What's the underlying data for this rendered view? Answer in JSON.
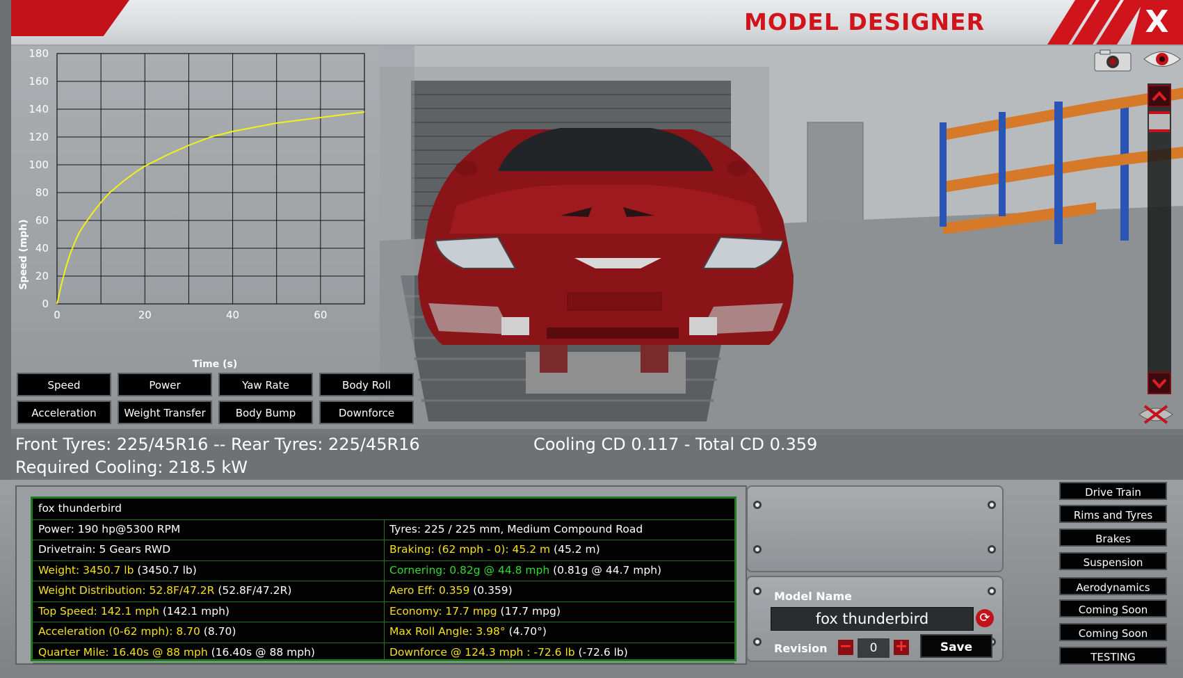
{
  "header": {
    "title": "MODEL DESIGNER",
    "close_label": "X"
  },
  "chart_panel": {
    "buttons": [
      {
        "label": "Speed"
      },
      {
        "label": "Power"
      },
      {
        "label": "Yaw Rate"
      },
      {
        "label": "Body Roll"
      },
      {
        "label": "Acceleration"
      },
      {
        "label": "Weight Transfer"
      },
      {
        "label": "Body Bump"
      },
      {
        "label": "Downforce"
      }
    ]
  },
  "chart_data": {
    "type": "line",
    "xlabel": "Time (s)",
    "ylabel": "Speed (mph)",
    "xlim": [
      0,
      70
    ],
    "ylim": [
      0,
      180
    ],
    "xticks": [
      0,
      20,
      40,
      60
    ],
    "yticks": [
      0,
      20,
      40,
      60,
      80,
      100,
      120,
      140,
      160,
      180
    ],
    "grid": true,
    "series": [
      {
        "color": "#f2f21a",
        "x": [
          0,
          1,
          2,
          3,
          4,
          5,
          6,
          8,
          10,
          12,
          15,
          18,
          20,
          25,
          30,
          35,
          40,
          45,
          50,
          55,
          60,
          65,
          70
        ],
        "y": [
          0,
          14,
          26,
          36,
          44,
          51,
          56,
          65,
          73,
          80,
          88,
          95,
          99,
          107,
          114,
          120,
          124,
          127,
          130,
          132,
          134,
          136,
          138
        ]
      }
    ]
  },
  "info_strip": {
    "tyres": "Front Tyres: 225/45R16 -- Rear Tyres: 225/45R16",
    "cooling_cd": "Cooling CD 0.117 - Total CD 0.359",
    "required_cooling": "Required Cooling: 218.5 kW"
  },
  "stats": {
    "name": "fox thunderbird",
    "rows": [
      {
        "left": "Power: 190 hp@5300 RPM",
        "left_value": "",
        "left_color": "white",
        "right": "Tyres: 225 / 225 mm, Medium Compound Road",
        "right_value": "",
        "right_color": "white"
      },
      {
        "left": "Drivetrain: 5 Gears RWD",
        "left_value": "",
        "left_color": "white",
        "right": "Braking: (62 mph - 0): 45.2 m",
        "right_value": " (45.2 m)",
        "right_color": "yellow"
      },
      {
        "left": "Weight: 3450.7 lb",
        "left_value": " (3450.7 lb)",
        "left_color": "yellow",
        "right": "Cornering: 0.82g @ 44.8 mph",
        "right_value": " (0.81g @ 44.7 mph)",
        "right_color": "green"
      },
      {
        "left": "Weight Distribution: 52.8F/47.2R",
        "left_value": " (52.8F/47.2R)",
        "left_color": "yellow",
        "right": "Aero Eff: 0.359",
        "right_value": " (0.359)",
        "right_color": "yellow"
      },
      {
        "left": "Top Speed: 142.1 mph",
        "left_value": " (142.1 mph)",
        "left_color": "yellow",
        "right": "Economy: 17.7 mpg",
        "right_value": " (17.7 mpg)",
        "right_color": "yellow"
      },
      {
        "left": "Acceleration (0-62 mph): 8.70",
        "left_value": " (8.70)",
        "left_color": "yellow",
        "right": "Max Roll Angle: 3.98°",
        "right_value": " (4.70°)",
        "right_color": "yellow"
      },
      {
        "left": "Quarter Mile: 16.40s @ 88 mph",
        "left_value": " (16.40s @ 88 mph)",
        "left_color": "yellow",
        "right": "Downforce @ 124.3 mph : -72.6 lb",
        "right_value": " (-72.6 lb)",
        "right_color": "yellow"
      }
    ]
  },
  "model_panel": {
    "model_name_label": "Model Name",
    "model_name_value": "fox thunderbird",
    "revision_label": "Revision",
    "revision_value": "0",
    "save_label": "Save"
  },
  "side_menu": {
    "items": [
      {
        "label": "Drive Train"
      },
      {
        "label": "Rims and Tyres"
      },
      {
        "label": "Brakes"
      },
      {
        "label": "Suspension"
      },
      {
        "label": "Aerodynamics"
      },
      {
        "label": "Coming Soon"
      },
      {
        "label": "Coming Soon"
      },
      {
        "label": "TESTING"
      }
    ]
  },
  "icons": {
    "camera": "camera-icon",
    "eye": "eye-icon",
    "scroll_up": "chevron-up-icon",
    "scroll_down": "chevron-down-icon",
    "hide_ui": "hide-view-icon",
    "reset_name": "refresh-icon"
  },
  "colors": {
    "brand_red": "#c4121a",
    "stat_yellow": "#f4e11c",
    "stat_green": "#2fdc2f",
    "car_body": "#8a1418"
  }
}
